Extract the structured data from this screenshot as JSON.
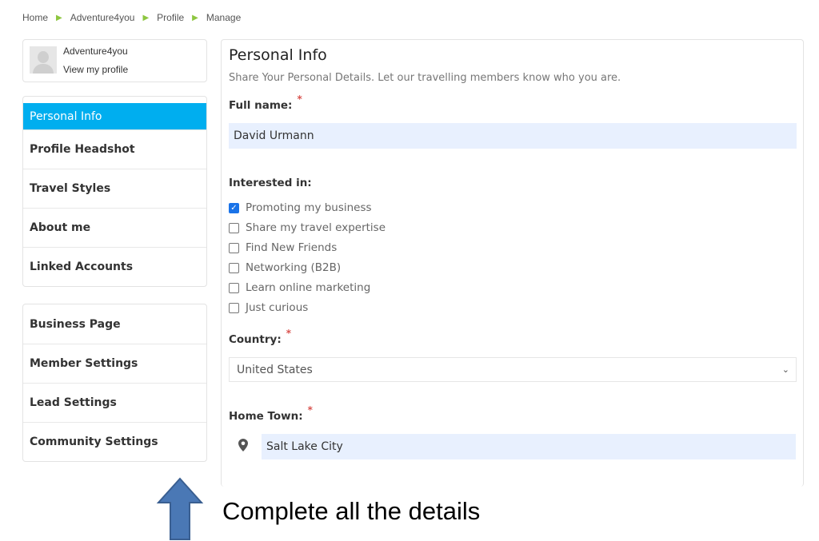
{
  "breadcrumb": [
    "Home",
    "Adventure4you",
    "Profile",
    "Manage"
  ],
  "profile": {
    "name": "Adventure4you",
    "link": "View my profile"
  },
  "menu1": [
    "Personal Info",
    "Profile Headshot",
    "Travel Styles",
    "About me",
    "Linked Accounts"
  ],
  "menu2": [
    "Business Page",
    "Member Settings",
    "Lead Settings",
    "Community Settings"
  ],
  "form": {
    "title": "Personal Info",
    "subtitle": "Share Your Personal Details. Let our travelling members know who you are.",
    "full_name_label": "Full name:",
    "full_name": "David Urmann",
    "interested_label": "Interested in:",
    "interests": [
      {
        "label": "Promoting my business",
        "checked": true
      },
      {
        "label": "Share my travel expertise",
        "checked": false
      },
      {
        "label": "Find New Friends",
        "checked": false
      },
      {
        "label": "Networking (B2B)",
        "checked": false
      },
      {
        "label": "Learn online marketing",
        "checked": false
      },
      {
        "label": "Just curious",
        "checked": false
      }
    ],
    "country_label": "Country:",
    "country": "United States",
    "hometown_label": "Home Town:",
    "hometown": "Salt Lake City",
    "required": "*"
  },
  "annotation": {
    "text": "Complete all the details",
    "arrow_color": "#4a78b5"
  },
  "colors": {
    "active": "#00aeef",
    "chevron": "#8dc63f"
  }
}
